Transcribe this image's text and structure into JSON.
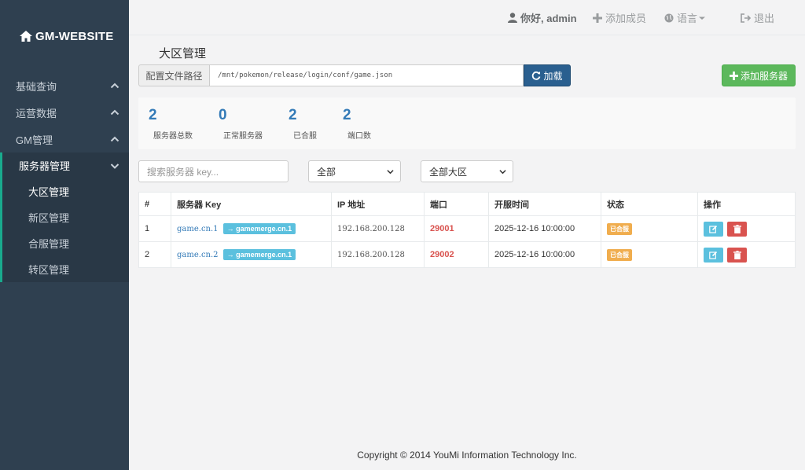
{
  "brand": "GM-WEBSITE",
  "sidebar": {
    "items": [
      {
        "label": "基础查询"
      },
      {
        "label": "运营数据"
      },
      {
        "label": "GM管理"
      },
      {
        "label": "服务器管理"
      }
    ],
    "sub": [
      "大区管理",
      "新区管理",
      "合服管理",
      "转区管理"
    ]
  },
  "topbar": {
    "greeting": "你好, admin",
    "add_member": "添加成员",
    "language": "语言",
    "logout": "退出"
  },
  "page": {
    "title": "大区管理",
    "config_label": "配置文件路径",
    "config_path": "/mnt/pokemon/release/login/conf/game.json",
    "load_button": "加载",
    "add_server_button": "添加服务器"
  },
  "stats": [
    {
      "num": "2",
      "label": "服务器总数"
    },
    {
      "num": "0",
      "label": "正常服务器"
    },
    {
      "num": "2",
      "label": "已合服"
    },
    {
      "num": "2",
      "label": "端口数"
    }
  ],
  "filters": {
    "search_placeholder": "搜索服务器 key...",
    "status_select": "全部",
    "region_select": "全部大区"
  },
  "table": {
    "headers": [
      "#",
      "服务器 Key",
      "IP 地址",
      "端口",
      "开服时间",
      "状态",
      "操作"
    ],
    "rows": [
      {
        "idx": "1",
        "key": "game.cn.1",
        "merge": "→ gamemerge.cn.1",
        "ip": "192.168.200.128",
        "port": "29001",
        "time": "2025-12-16 10:00:00",
        "status": "已合服"
      },
      {
        "idx": "2",
        "key": "game.cn.2",
        "merge": "→ gamemerge.cn.1",
        "ip": "192.168.200.128",
        "port": "29002",
        "time": "2025-12-16 10:00:00",
        "status": "已合服"
      }
    ]
  },
  "footer": "Copyright © 2014 YouMi Information Technology Inc."
}
